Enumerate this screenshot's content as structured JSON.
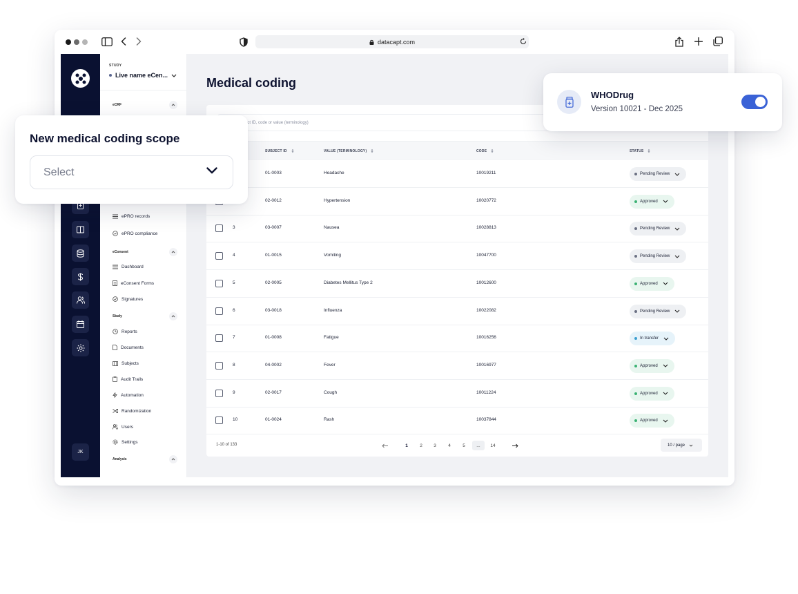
{
  "browser": {
    "url": "datacapt.com"
  },
  "sidebar": {
    "study_label": "STUDY",
    "study_name": "Live name eCen...",
    "sections": [
      {
        "label": "eCRF"
      },
      {
        "label": "eConsent"
      },
      {
        "label": "Study"
      },
      {
        "label": "Analysis"
      }
    ],
    "epro_items": [
      "ePRO records",
      "ePRO compliance"
    ],
    "econsent_items": [
      "Dashboard",
      "eConsent Forms",
      "Signatures"
    ],
    "study_items": [
      "Reports",
      "Documents",
      "Subjects",
      "Audit Trails",
      "Automation",
      "Randomization",
      "Users",
      "Settings"
    ],
    "user_initials": "JK"
  },
  "main": {
    "title": "Medical coding",
    "search_placeholder": "...h by subject ID, code or value (terminology)",
    "columns": [
      "SUBJECT ID",
      "VALUE (TERMINOLOGY)",
      "CODE",
      "STATUS"
    ],
    "rows": [
      {
        "num": "",
        "subject": "01-0003",
        "value": "Headache",
        "code": "10019211",
        "status": "Pending Review"
      },
      {
        "num": "",
        "subject": "02-0012",
        "value": "Hypertension",
        "code": "10020772",
        "status": "Approved"
      },
      {
        "num": "3",
        "subject": "03-0007",
        "value": "Nausea",
        "code": "10028813",
        "status": "Pending Review"
      },
      {
        "num": "4",
        "subject": "01-0015",
        "value": "Vomiting",
        "code": "10047700",
        "status": "Pending Review"
      },
      {
        "num": "5",
        "subject": "02-0005",
        "value": "Diabetes Mellitus Type 2",
        "code": "10012600",
        "status": "Approved"
      },
      {
        "num": "6",
        "subject": "03-0018",
        "value": "Influenza",
        "code": "10022082",
        "status": "Pending Review"
      },
      {
        "num": "7",
        "subject": "01-0008",
        "value": "Fatigue",
        "code": "10016256",
        "status": "In transfer"
      },
      {
        "num": "8",
        "subject": "04-0002",
        "value": "Fever",
        "code": "10016977",
        "status": "Approved"
      },
      {
        "num": "9",
        "subject": "02-0017",
        "value": "Cough",
        "code": "10011224",
        "status": "Approved"
      },
      {
        "num": "10",
        "subject": "01-0024",
        "value": "Rash",
        "code": "10037844",
        "status": "Approved"
      }
    ],
    "status_colors": {
      "Pending Review": {
        "bg": "#eef0f3",
        "dot": "#6b7083"
      },
      "Approved": {
        "bg": "#e8f6ef",
        "dot": "#3bb273"
      },
      "In transfer": {
        "bg": "#e6f3fa",
        "dot": "#3b9fd0"
      }
    },
    "footer": {
      "count": "1-10 of 133",
      "pages": [
        "1",
        "2",
        "3",
        "4",
        "5",
        "...",
        "14"
      ],
      "active_page": "1",
      "per_page": "10 / page"
    }
  },
  "scope_popup": {
    "title": "New medical coding scope",
    "select_placeholder": "Select"
  },
  "whodrug_popup": {
    "title": "WHODrug",
    "version": "Version 10021 - Dec 2025",
    "enabled": true,
    "toggle_color": "#3a62d6"
  }
}
